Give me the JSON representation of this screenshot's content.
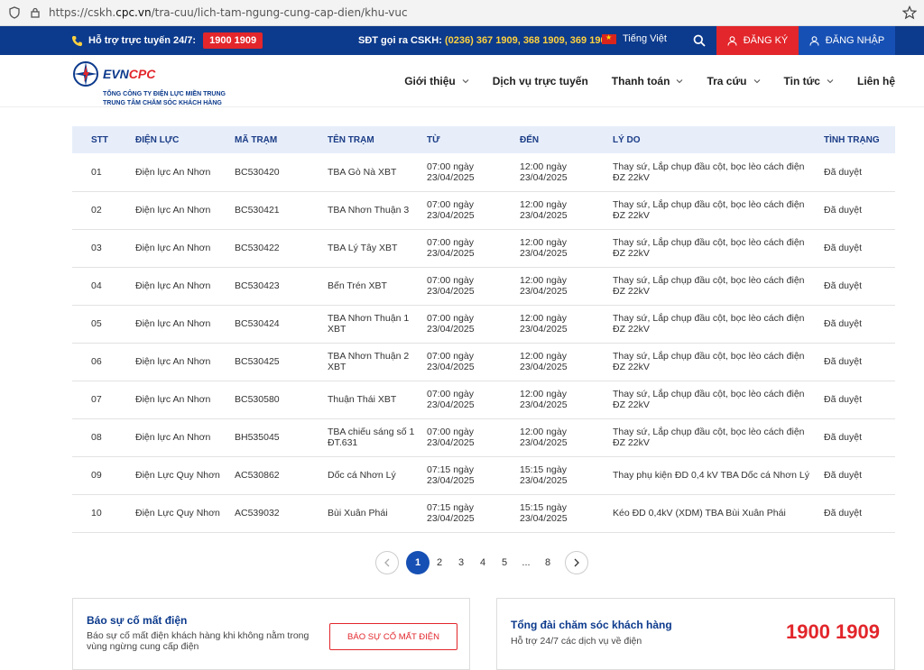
{
  "browser": {
    "url_prefix": "https://cskh.",
    "url_domain": "cpc.vn",
    "url_path": "/tra-cuu/lich-tam-ngung-cung-cap-dien/khu-vuc"
  },
  "topbar": {
    "support_label": "Hỗ trợ trực tuyến 24/7:",
    "hotline": "1900 1909",
    "cskh_label": "SĐT gọi ra CSKH:",
    "cskh_numbers": "(0236) 367 1909, 368 1909, 369 1909",
    "language": "Tiếng Việt",
    "register": "ĐĂNG KÝ",
    "login": "ĐĂNG NHẬP"
  },
  "logo": {
    "brand_evn": "EVN",
    "brand_cpc": "CPC",
    "sub1": "TỔNG CÔNG TY ĐIỆN LỰC MIỀN TRUNG",
    "sub2": "TRUNG TÂM CHĂM SÓC KHÁCH HÀNG"
  },
  "nav": [
    {
      "label": "Giới thiệu",
      "dropdown": true
    },
    {
      "label": "Dịch vụ trực tuyến",
      "dropdown": false
    },
    {
      "label": "Thanh toán",
      "dropdown": true
    },
    {
      "label": "Tra cứu",
      "dropdown": true
    },
    {
      "label": "Tin tức",
      "dropdown": true
    },
    {
      "label": "Liên hệ",
      "dropdown": false
    }
  ],
  "table": {
    "headers": [
      "STT",
      "ĐIỆN LỰC",
      "MÃ TRẠM",
      "TÊN TRẠM",
      "TỪ",
      "ĐẾN",
      "LÝ DO",
      "TÌNH TRẠNG"
    ],
    "rows": [
      [
        "01",
        "Điện lực An Nhơn",
        "BC530420",
        "TBA Gò Nà XBT",
        "07:00 ngày 23/04/2025",
        "12:00 ngày 23/04/2025",
        "Thay sứ, Lắp chụp đầu cột, bọc lèo cách điện ĐZ 22kV",
        "Đã duyệt"
      ],
      [
        "02",
        "Điện lực An Nhơn",
        "BC530421",
        "TBA Nhơn Thuận 3",
        "07:00 ngày 23/04/2025",
        "12:00 ngày 23/04/2025",
        "Thay sứ, Lắp chụp đầu cột, bọc lèo cách điện ĐZ 22kV",
        "Đã duyệt"
      ],
      [
        "03",
        "Điện lực An Nhơn",
        "BC530422",
        "TBA Lý Tây XBT",
        "07:00 ngày 23/04/2025",
        "12:00 ngày 23/04/2025",
        "Thay sứ, Lắp chụp đầu cột, bọc lèo cách điện ĐZ 22kV",
        "Đã duyệt"
      ],
      [
        "04",
        "Điện lực An Nhơn",
        "BC530423",
        "Bến Trén XBT",
        "07:00 ngày 23/04/2025",
        "12:00 ngày 23/04/2025",
        "Thay sứ, Lắp chụp đầu cột, bọc lèo cách điện ĐZ 22kV",
        "Đã duyệt"
      ],
      [
        "05",
        "Điện lực An Nhơn",
        "BC530424",
        "TBA Nhơn Thuận 1 XBT",
        "07:00 ngày 23/04/2025",
        "12:00 ngày 23/04/2025",
        "Thay sứ, Lắp chụp đầu cột, bọc lèo cách điện ĐZ 22kV",
        "Đã duyệt"
      ],
      [
        "06",
        "Điện lực An Nhơn",
        "BC530425",
        "TBA Nhơn Thuận 2 XBT",
        "07:00 ngày 23/04/2025",
        "12:00 ngày 23/04/2025",
        "Thay sứ, Lắp chụp đầu cột, bọc lèo cách điện ĐZ 22kV",
        "Đã duyệt"
      ],
      [
        "07",
        "Điện lực An Nhơn",
        "BC530580",
        "Thuận Thái XBT",
        "07:00 ngày 23/04/2025",
        "12:00 ngày 23/04/2025",
        "Thay sứ, Lắp chụp đầu cột, bọc lèo cách điện ĐZ 22kV",
        "Đã duyệt"
      ],
      [
        "08",
        "Điện lực An Nhơn",
        "BH535045",
        "TBA chiếu sáng số 1 ĐT.631",
        "07:00 ngày 23/04/2025",
        "12:00 ngày 23/04/2025",
        "Thay sứ, Lắp chụp đầu cột, bọc lèo cách điện ĐZ 22kV",
        "Đã duyệt"
      ],
      [
        "09",
        "Điện Lực Quy Nhơn",
        "AC530862",
        "Dốc cá Nhơn Lý",
        "07:15 ngày 23/04/2025",
        "15:15 ngày 23/04/2025",
        "Thay phụ kiện ĐD 0,4 kV TBA Dốc cá Nhơn Lý",
        "Đã duyệt"
      ],
      [
        "10",
        "Điện Lực Quy Nhơn",
        "AC539032",
        "Bùi Xuân Phái",
        "07:15 ngày 23/04/2025",
        "15:15 ngày 23/04/2025",
        "Kéo ĐD 0,4kV (XDM) TBA Bùi Xuân Phái",
        "Đã duyệt"
      ]
    ]
  },
  "pagination": {
    "pages": [
      "1",
      "2",
      "3",
      "4",
      "5",
      "...",
      "8"
    ],
    "current": "1"
  },
  "report_card": {
    "title": "Báo sự cố mất điện",
    "description": "Báo sự cố mất điện khách hàng khi không nằm trong vùng ngừng cung cấp điện",
    "button": "BÁO SỰ CỐ MẤT ĐIỆN"
  },
  "callcenter_card": {
    "title": "Tổng đài chăm sóc khách hàng",
    "description": "Hỗ trợ 24/7 các dịch vụ về điện",
    "phone": "1900 1909"
  },
  "colors": {
    "primary": "#0c3a8c",
    "accent_red": "#e2262b",
    "login_blue": "#1750b4",
    "header_row": "#e7eefa"
  }
}
